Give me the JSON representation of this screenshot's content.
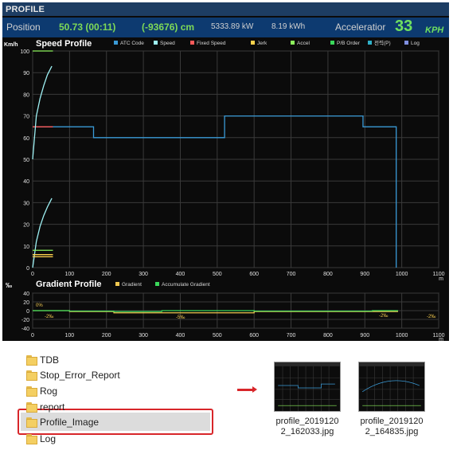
{
  "window": {
    "title": "PROFILE"
  },
  "status": {
    "position_label": "Position",
    "position_value": "50.73 (00:11)",
    "offset_value": "(-93676) cm",
    "power": "5333.89 kW",
    "energy": "8.19 kWh",
    "accel_label": "Acceleratior",
    "accel_value": "33",
    "accel_unit": "KPH"
  },
  "speed_panel": {
    "title": "Speed Profile",
    "y_unit": "Km/h",
    "x_unit": "m",
    "legend": [
      "ATC Code",
      "Speed",
      "Fixed Speed",
      "Jerk",
      "Accel",
      "P/B Order",
      "전력(P)",
      "Log"
    ]
  },
  "gradient_panel": {
    "title": "Gradient Profile",
    "y_unit": "‰",
    "x_unit": "m",
    "legend": [
      "Gradient",
      "Accumulate Gradient"
    ],
    "annotations": [
      "0%",
      "-2‰",
      "-5‰",
      "-2‰",
      "-2‰"
    ]
  },
  "colors": {
    "atc": "#3a9ad6",
    "speed": "#9ef1f4",
    "fixed_speed": "#ff5a5a",
    "jerk": "#ffd24d",
    "accel": "#8cf25c",
    "pb_order": "#3ad85a",
    "power": "#2fb0c8",
    "log": "#7f8fe0",
    "gradient": "#f0c850",
    "accum_gradient": "#3ad85a"
  },
  "chart_data": [
    {
      "type": "line",
      "title": "Speed Profile",
      "ylabel": "Km/h",
      "xlabel": "m",
      "xlim": [
        0,
        1100
      ],
      "ylim": [
        0,
        100
      ],
      "x_ticks": [
        0,
        100,
        200,
        300,
        400,
        500,
        600,
        700,
        800,
        900,
        1000,
        1100
      ],
      "y_ticks": [
        0,
        10,
        20,
        30,
        40,
        50,
        60,
        70,
        80,
        90,
        100
      ],
      "grid": true,
      "legend_position": "top",
      "series": [
        {
          "name": "ATC Code",
          "x": [
            0,
            165,
            165,
            520,
            520,
            895,
            895,
            985,
            985
          ],
          "y": [
            65,
            65,
            60,
            60,
            70,
            70,
            65,
            65,
            0
          ]
        },
        {
          "name": "Fixed Speed",
          "x": [
            0,
            55
          ],
          "y": [
            65,
            65
          ]
        },
        {
          "name": "Speed",
          "x": [
            0,
            10,
            20,
            30,
            40,
            52
          ],
          "y": [
            0,
            12,
            19,
            24,
            28,
            32
          ]
        },
        {
          "name": "Speed",
          "x": [
            0,
            10,
            20,
            30,
            40,
            52
          ],
          "y": [
            50,
            70,
            78,
            84,
            89,
            93
          ]
        },
        {
          "name": "Accel",
          "x": [
            0,
            55
          ],
          "y": [
            100,
            100
          ]
        },
        {
          "name": "Accel",
          "x": [
            0,
            55
          ],
          "y": [
            8,
            8
          ]
        },
        {
          "name": "Jerk",
          "x": [
            0,
            55
          ],
          "y": [
            6,
            6
          ]
        },
        {
          "name": "Jerk",
          "x": [
            0,
            55
          ],
          "y": [
            5,
            5
          ]
        }
      ]
    },
    {
      "type": "line",
      "title": "Gradient Profile",
      "ylabel": "‰",
      "xlabel": "m",
      "xlim": [
        0,
        1100
      ],
      "ylim": [
        -40,
        40
      ],
      "x_ticks": [
        0,
        100,
        200,
        300,
        400,
        500,
        600,
        700,
        800,
        900,
        1000,
        1100
      ],
      "y_ticks": [
        40,
        20,
        0,
        -20,
        -40
      ],
      "grid": true,
      "legend_position": "top",
      "series": [
        {
          "name": "Gradient",
          "x": [
            0,
            100,
            220,
            350,
            600,
            920,
            990
          ],
          "y": [
            0,
            -2,
            -5,
            -5,
            -2,
            -2,
            -2
          ]
        },
        {
          "name": "Accumulate Gradient",
          "x": [
            0,
            100,
            220,
            350,
            600,
            920,
            990
          ],
          "y": [
            0,
            -1,
            -2,
            0,
            -1,
            0,
            0
          ]
        }
      ]
    }
  ],
  "explorer": {
    "folders": [
      "TDB",
      "Stop_Error_Report",
      "Rog",
      "report",
      "Profile_Image",
      "Log"
    ],
    "selected": "Profile_Image",
    "files": [
      "profile_2019120\n2_162033.jpg",
      "profile_2019120\n2_164835.jpg"
    ]
  }
}
